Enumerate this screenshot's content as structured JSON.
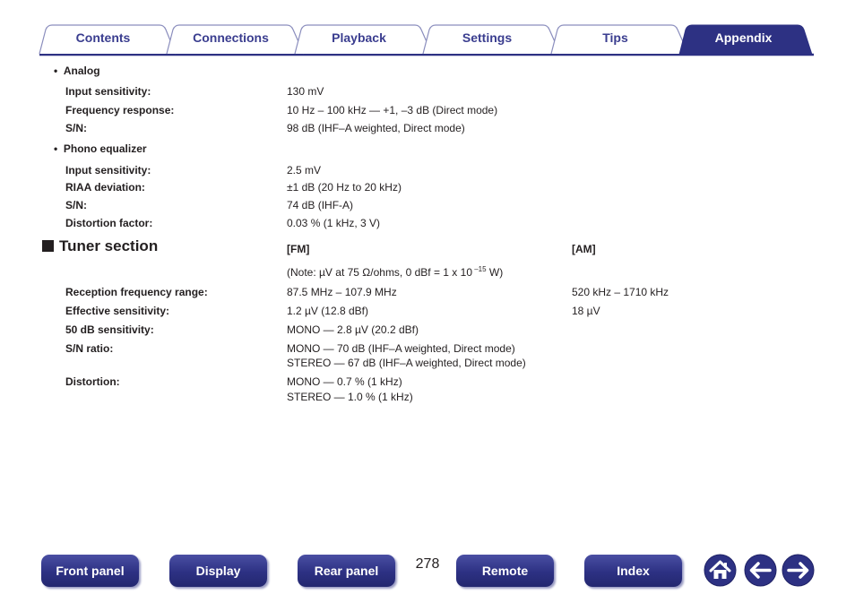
{
  "tabs": [
    {
      "label": "Contents",
      "active": false
    },
    {
      "label": "Connections",
      "active": false
    },
    {
      "label": "Playback",
      "active": false
    },
    {
      "label": "Settings",
      "active": false
    },
    {
      "label": "Tips",
      "active": false
    },
    {
      "label": "Appendix",
      "active": true
    }
  ],
  "analog": {
    "heading": "Analog",
    "rows": [
      {
        "label": "Input sensitivity:",
        "value": "130 mV"
      },
      {
        "label": "Frequency response:",
        "value": "10 Hz – 100 kHz — +1, –3 dB (Direct mode)"
      },
      {
        "label": "S/N:",
        "value": "98 dB (IHF–A weighted, Direct mode)"
      }
    ]
  },
  "phono": {
    "heading": "Phono equalizer",
    "rows": [
      {
        "label": "Input sensitivity:",
        "value": "2.5 mV"
      },
      {
        "label": "RIAA deviation:",
        "value": "±1 dB (20 Hz to 20 kHz)"
      },
      {
        "label": "S/N:",
        "value": "74 dB (IHF-A)"
      },
      {
        "label": "Distortion factor:",
        "value": "0.03 % (1 kHz, 3 V)"
      }
    ]
  },
  "tuner": {
    "title": "Tuner section",
    "fm_header": "[FM]",
    "am_header": "[AM]",
    "note_prefix": "(Note: µV at 75 Ω/ohms, 0 dBf = 1 x 10",
    "note_exp": " –15",
    "note_suffix": " W)",
    "rows": [
      {
        "label": "Reception frequency range:",
        "fm": "87.5 MHz – 107.9 MHz",
        "am": "520 kHz – 1710 kHz"
      },
      {
        "label": "Effective sensitivity:",
        "fm": "1.2 µV (12.8 dBf)",
        "am": "18 µV"
      },
      {
        "label": "50 dB sensitivity:",
        "fm": "MONO — 2.8 µV (20.2 dBf)",
        "am": ""
      },
      {
        "label": "S/N ratio:",
        "fm": "MONO — 70 dB (IHF–A weighted, Direct mode)",
        "fm2": "STEREO — 67 dB (IHF–A weighted, Direct mode)",
        "am": ""
      },
      {
        "label": "Distortion:",
        "fm": "MONO — 0.7 % (1 kHz)",
        "fm2": "STEREO — 1.0 % (1 kHz)",
        "am": ""
      }
    ]
  },
  "page_number": "278",
  "nav": {
    "front_panel": "Front panel",
    "display": "Display",
    "rear_panel": "Rear panel",
    "remote": "Remote",
    "index": "Index"
  },
  "icons": {
    "home": "home-icon",
    "back": "arrow-left-icon",
    "forward": "arrow-right-icon"
  },
  "colors": {
    "tab_text": "#3a3d8f",
    "accent": "#2d3183",
    "tab_border": "#6b6fae"
  }
}
